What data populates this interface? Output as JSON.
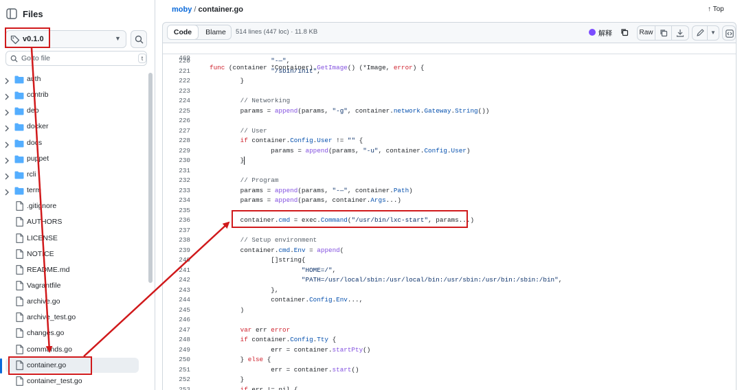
{
  "sidebar": {
    "title": "Files",
    "branch": "v0.1.0",
    "search_placeholder": "Go to file",
    "search_shortcut": "t",
    "tree": [
      {
        "name": "auth",
        "type": "folder"
      },
      {
        "name": "contrib",
        "type": "folder"
      },
      {
        "name": "deb",
        "type": "folder"
      },
      {
        "name": "docker",
        "type": "folder"
      },
      {
        "name": "docs",
        "type": "folder"
      },
      {
        "name": "puppet",
        "type": "folder"
      },
      {
        "name": "rcli",
        "type": "folder"
      },
      {
        "name": "term",
        "type": "folder"
      },
      {
        "name": ".gitignore",
        "type": "file"
      },
      {
        "name": "AUTHORS",
        "type": "file"
      },
      {
        "name": "LICENSE",
        "type": "file"
      },
      {
        "name": "NOTICE",
        "type": "file"
      },
      {
        "name": "README.md",
        "type": "file"
      },
      {
        "name": "Vagrantfile",
        "type": "file"
      },
      {
        "name": "archive.go",
        "type": "file"
      },
      {
        "name": "archive_test.go",
        "type": "file"
      },
      {
        "name": "changes.go",
        "type": "file"
      },
      {
        "name": "commands.go",
        "type": "file"
      },
      {
        "name": "container.go",
        "type": "file",
        "selected": true
      },
      {
        "name": "container_test.go",
        "type": "file"
      }
    ]
  },
  "breadcrumb": {
    "repo": "moby",
    "separator": "/",
    "file": "container.go"
  },
  "top_link": "↑ Top",
  "toolbar": {
    "code_tab": "Code",
    "blame_tab": "Blame",
    "file_info": "514 lines (447 loc) · 11.8 KB",
    "ai_label": "解释",
    "raw_label": "Raw"
  },
  "sticky_line": {
    "num": "469",
    "code": "func (container *Container) GetImage() (*Image, error) {"
  },
  "code_lines": [
    {
      "num": "220",
      "code": "                \"-—\","
    },
    {
      "num": "221",
      "code": "                \"/sbin/init\","
    },
    {
      "num": "222",
      "code": "        }"
    },
    {
      "num": "223",
      "code": ""
    },
    {
      "num": "224",
      "code": "        // Networking"
    },
    {
      "num": "225",
      "code": "        params = append(params, \"-g\", container.network.Gateway.String())"
    },
    {
      "num": "226",
      "code": ""
    },
    {
      "num": "227",
      "code": "        // User"
    },
    {
      "num": "228",
      "code": "        if container.Config.User != \"\" {"
    },
    {
      "num": "229",
      "code": "                params = append(params, \"-u\", container.Config.User)"
    },
    {
      "num": "230",
      "code": "        }"
    },
    {
      "num": "231",
      "code": ""
    },
    {
      "num": "232",
      "code": "        // Program"
    },
    {
      "num": "233",
      "code": "        params = append(params, \"-—\", container.Path)"
    },
    {
      "num": "234",
      "code": "        params = append(params, container.Args...)"
    },
    {
      "num": "235",
      "code": ""
    },
    {
      "num": "236",
      "code": "        container.cmd = exec.Command(\"/usr/bin/lxc-start\", params...)"
    },
    {
      "num": "237",
      "code": ""
    },
    {
      "num": "238",
      "code": "        // Setup environment"
    },
    {
      "num": "239",
      "code": "        container.cmd.Env = append("
    },
    {
      "num": "240",
      "code": "                []string{"
    },
    {
      "num": "241",
      "code": "                        \"HOME=/\","
    },
    {
      "num": "242",
      "code": "                        \"PATH=/usr/local/sbin:/usr/local/bin:/usr/sbin:/usr/bin:/sbin:/bin\","
    },
    {
      "num": "243",
      "code": "                },"
    },
    {
      "num": "244",
      "code": "                container.Config.Env...,"
    },
    {
      "num": "245",
      "code": "        )"
    },
    {
      "num": "246",
      "code": ""
    },
    {
      "num": "247",
      "code": "        var err error"
    },
    {
      "num": "248",
      "code": "        if container.Config.Tty {"
    },
    {
      "num": "249",
      "code": "                err = container.startPty()"
    },
    {
      "num": "250",
      "code": "        } else {"
    },
    {
      "num": "251",
      "code": "                err = container.start()"
    },
    {
      "num": "252",
      "code": "        }"
    },
    {
      "num": "253",
      "code": "        if err != nil {"
    }
  ],
  "colors": {
    "accent": "#0969da",
    "annotation": "#d0191b",
    "folder": "#54aeff"
  }
}
